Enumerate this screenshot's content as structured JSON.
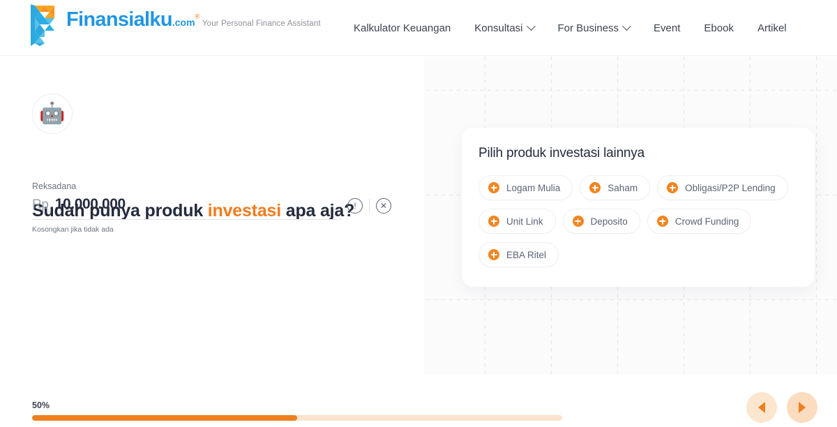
{
  "header": {
    "brand": {
      "name": "Finansialku",
      "dotcom": ".com",
      "registered": "®",
      "tagline": "Your Personal Finance Assistant",
      "logo_icon": "finansialku-f-logo-icon",
      "color_blue": "#2196e3",
      "color_orange": "#f07d1e"
    },
    "nav": [
      {
        "label": "Kalkulator Keuangan",
        "has_dropdown": false
      },
      {
        "label": "Konsultasi",
        "has_dropdown": true
      },
      {
        "label": "For Business",
        "has_dropdown": true
      },
      {
        "label": "Event",
        "has_dropdown": false
      },
      {
        "label": "Ebook",
        "has_dropdown": false
      },
      {
        "label": "Artikel",
        "has_dropdown": false
      }
    ]
  },
  "left_pane": {
    "avatar_icon": "🤖",
    "question_prefix": "Sudah punya produk ",
    "question_highlight": "investasi",
    "question_suffix": " apa aja?",
    "field": {
      "label": "Reksadana",
      "currency": "Rp",
      "value": "10.000.000",
      "hint": "Kosongkan jika tidak ada",
      "info_icon": "!",
      "remove_icon": "✕"
    }
  },
  "right_pane": {
    "card": {
      "title": "Pilih produk investasi lainnya",
      "chips": [
        {
          "label": "Logam Mulia"
        },
        {
          "label": "Saham"
        },
        {
          "label": "Obligasi/P2P Lending"
        },
        {
          "label": "Unit Link"
        },
        {
          "label": "Deposito"
        },
        {
          "label": "Crowd Funding"
        },
        {
          "label": "EBA Ritel"
        }
      ]
    }
  },
  "footer": {
    "progress_label": "50%",
    "progress_percent": 50,
    "prev_icon": "triangle-left",
    "next_icon": "triangle-right",
    "accent_color": "#ee7f1c"
  }
}
